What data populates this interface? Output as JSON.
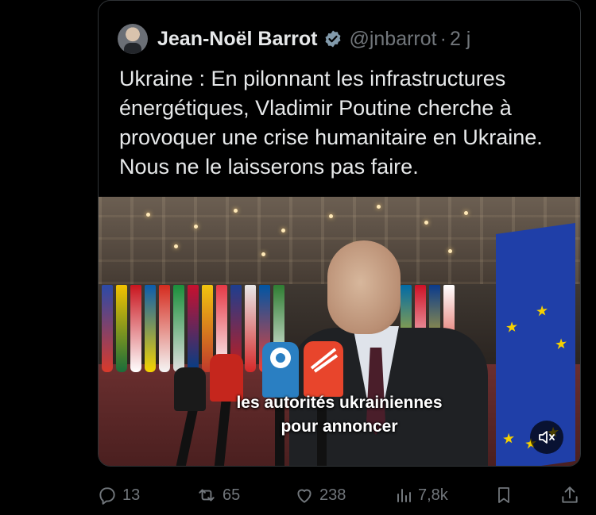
{
  "post": {
    "author_name": "Jean-Noël Barrot",
    "handle": "@jnbarrot",
    "separator": "·",
    "time": "2 j",
    "text": "Ukraine : En pilonnant les infrastructures énergétiques, Vladimir Poutine cherche à provoquer une crise humanitaire en Ukraine. Nous ne le laisserons pas faire.",
    "verified_icon": "verified-badge-icon",
    "colors": {
      "text": "#e7e9ea",
      "muted": "#71767b",
      "border": "#2f3336",
      "verified": "#829aab"
    }
  },
  "video": {
    "subtitle_line1": "les autorités ukrainiennes",
    "subtitle_line2": "pour annoncer",
    "mute_icon": "volume-muted-icon"
  },
  "actions": {
    "reply_count": "13",
    "repost_count": "65",
    "like_count": "238",
    "views_count": "7,8k",
    "reply_icon": "reply-icon",
    "repost_icon": "repost-icon",
    "like_icon": "heart-icon",
    "views_icon": "views-icon",
    "bookmark_icon": "bookmark-icon",
    "share_icon": "share-icon"
  }
}
